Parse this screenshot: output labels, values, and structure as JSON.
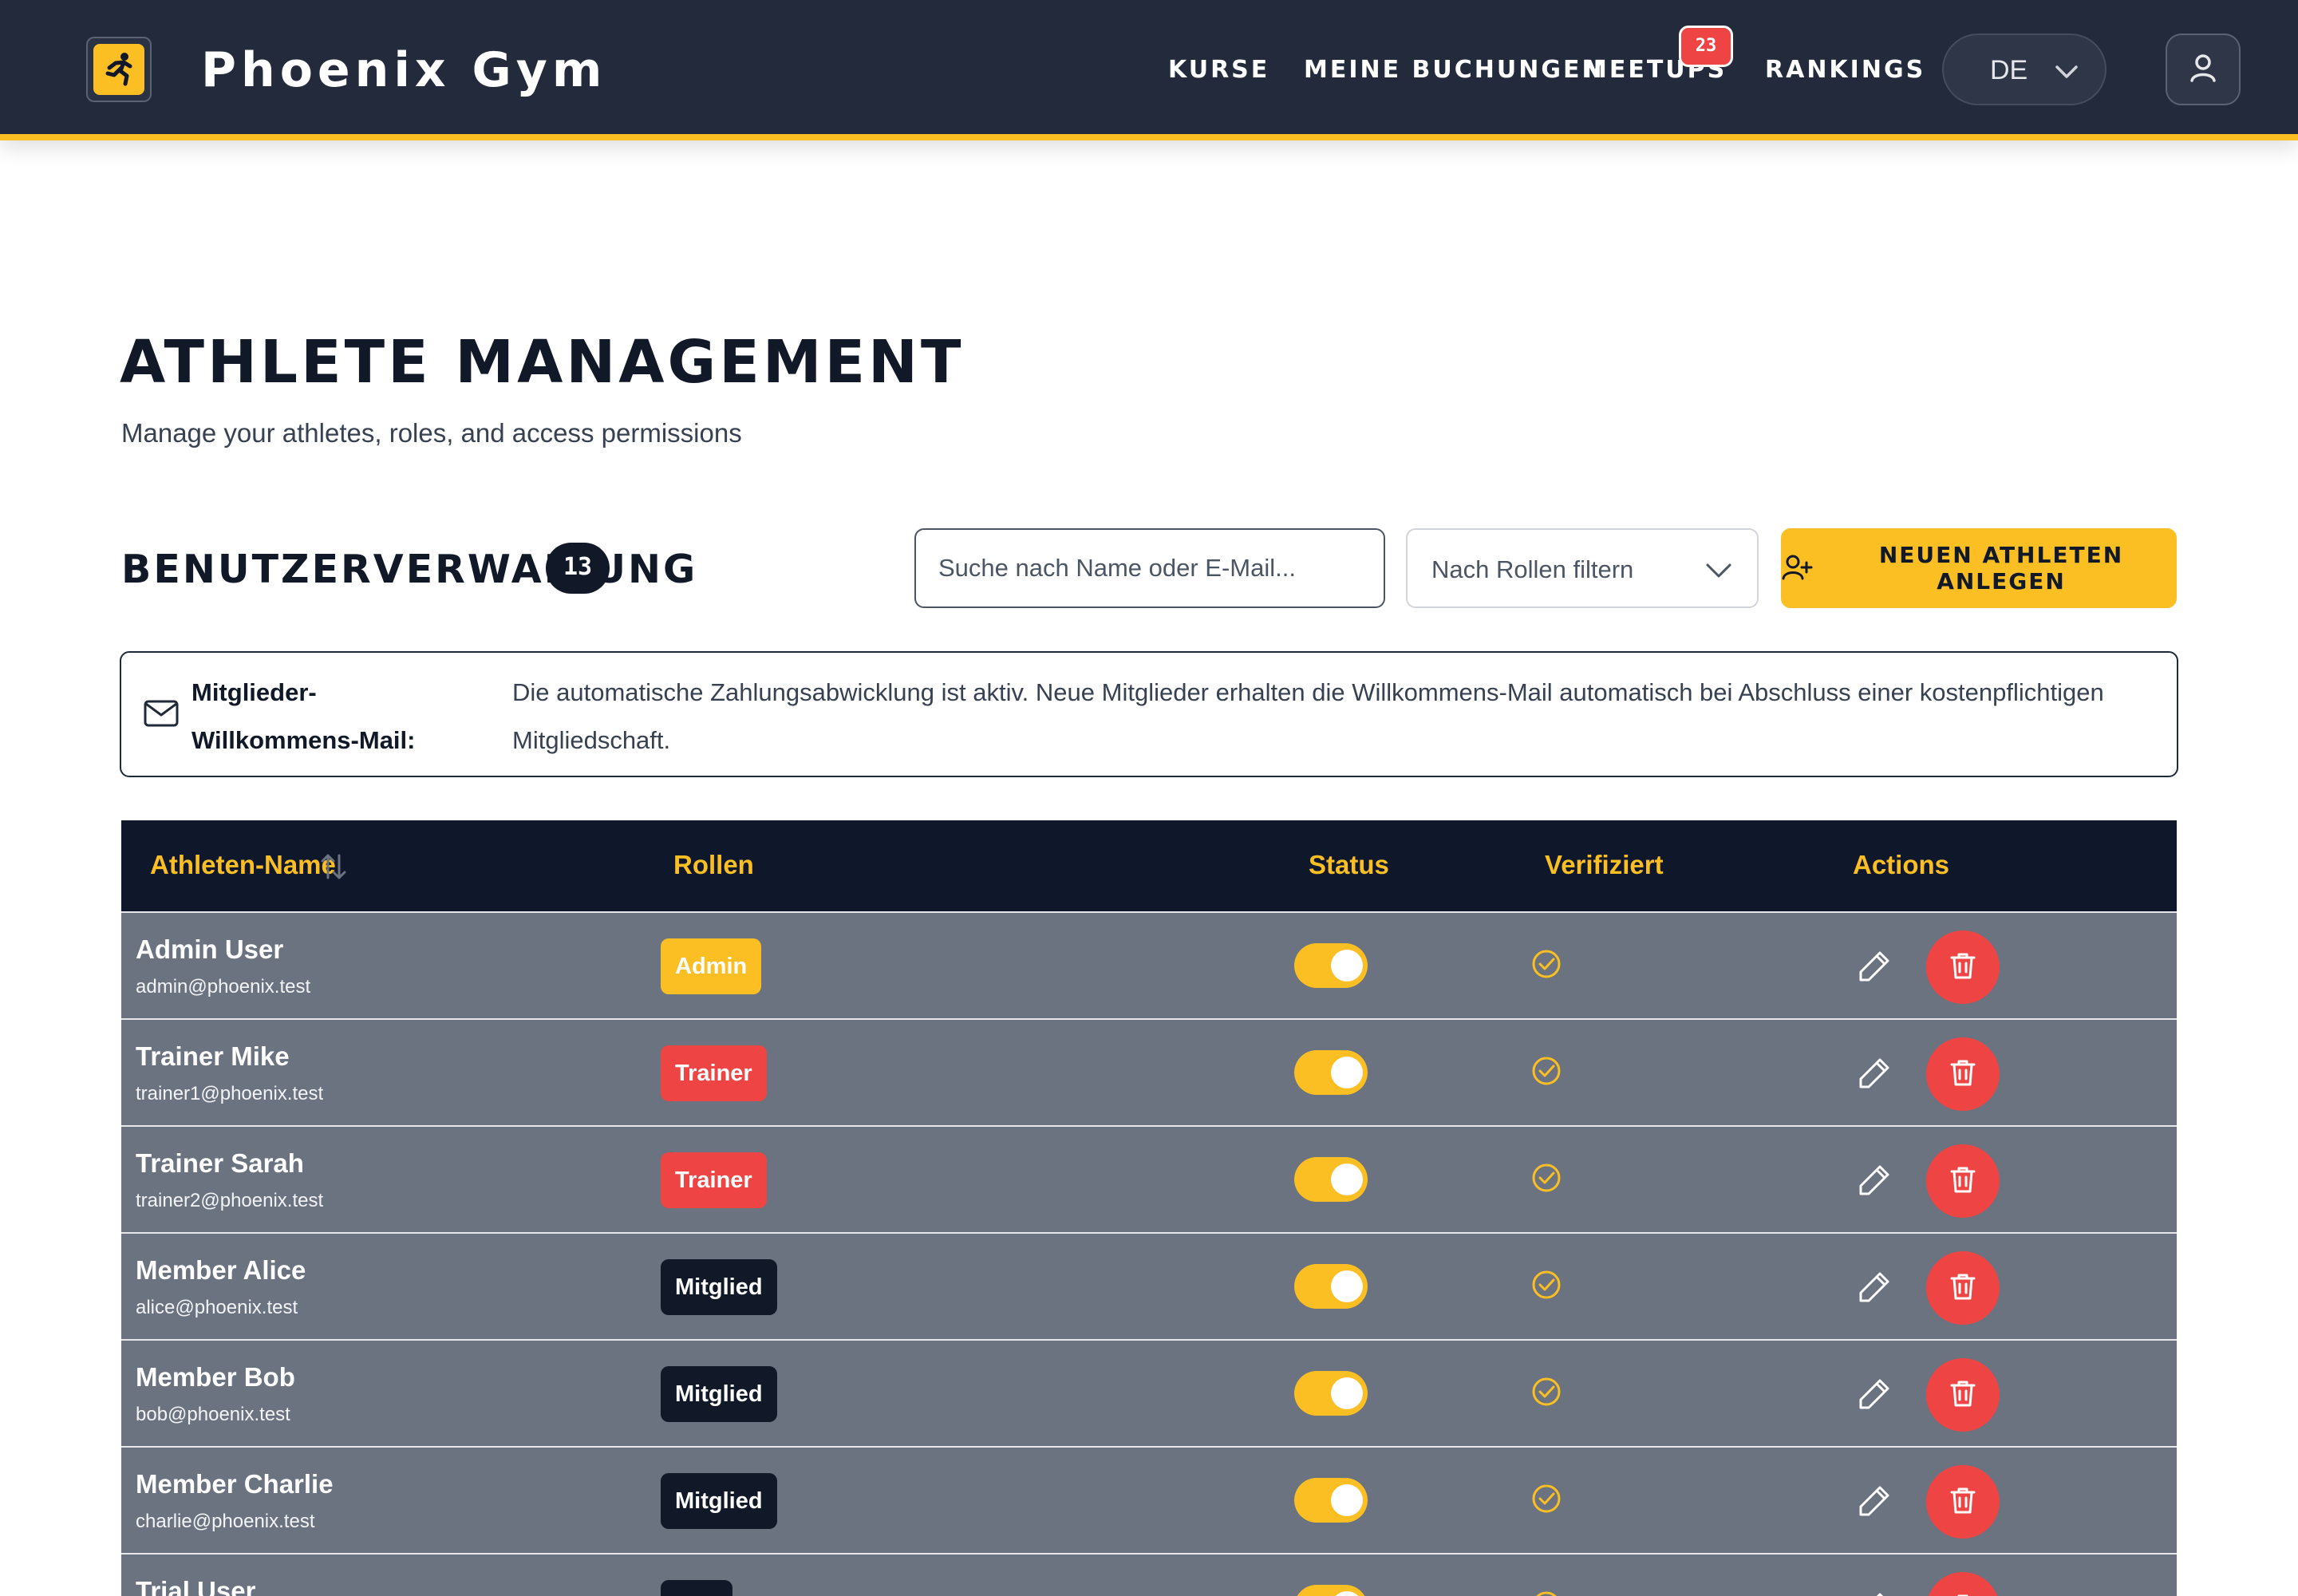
{
  "app": {
    "brand": "Phoenix Gym",
    "logo_icon": "runner-icon"
  },
  "nav": {
    "links": [
      "KURSE",
      "MEINE BUCHUNGEN",
      "MEETUPS",
      "RANKINGS"
    ],
    "meetups_badge": "23",
    "language": "DE"
  },
  "page": {
    "title": "ATHLETE MANAGEMENT",
    "subtitle": "Manage your athletes, roles, and access permissions"
  },
  "section": {
    "title": "BENUTZERVERWALTUNG",
    "count": "13"
  },
  "toolbar": {
    "search_placeholder": "Suche nach Name oder E-Mail...",
    "role_filter_placeholder": "Nach Rollen filtern",
    "add_label": "NEUEN ATHLETEN ANLEGEN"
  },
  "info": {
    "label": "Mitglieder-Willkommens-Mail:",
    "text": "Die automatische Zahlungsabwicklung ist aktiv. Neue Mitglieder erhalten die Willkommens-Mail automatisch bei Abschluss einer kostenpflichtigen Mitgliedschaft."
  },
  "table": {
    "headers": {
      "name": "Athleten-Name",
      "roles": "Rollen",
      "status": "Status",
      "verified": "Verifiziert",
      "actions": "Actions"
    },
    "rows": [
      {
        "name": "Admin User",
        "email": "admin@phoenix.test",
        "role": "Admin",
        "active": true,
        "verified": true
      },
      {
        "name": "Trainer Mike",
        "email": "trainer1@phoenix.test",
        "role": "Trainer",
        "active": true,
        "verified": true
      },
      {
        "name": "Trainer Sarah",
        "email": "trainer2@phoenix.test",
        "role": "Trainer",
        "active": true,
        "verified": true
      },
      {
        "name": "Member Alice",
        "email": "alice@phoenix.test",
        "role": "Mitglied",
        "active": true,
        "verified": true
      },
      {
        "name": "Member Bob",
        "email": "bob@phoenix.test",
        "role": "Mitglied",
        "active": true,
        "verified": true
      },
      {
        "name": "Member Charlie",
        "email": "charlie@phoenix.test",
        "role": "Mitglied",
        "active": true,
        "verified": true
      },
      {
        "name": "Trial User",
        "email": "",
        "role": "",
        "active": true,
        "verified": true
      }
    ]
  },
  "colors": {
    "accent": "#fbbf24",
    "navbar": "#232a3b",
    "danger": "#ef4444",
    "table_header": "#0f172a",
    "row_bg": "#6b7280",
    "role_admin": "#fbbf24",
    "role_trainer": "#ef4444",
    "role_member": "#111827"
  }
}
